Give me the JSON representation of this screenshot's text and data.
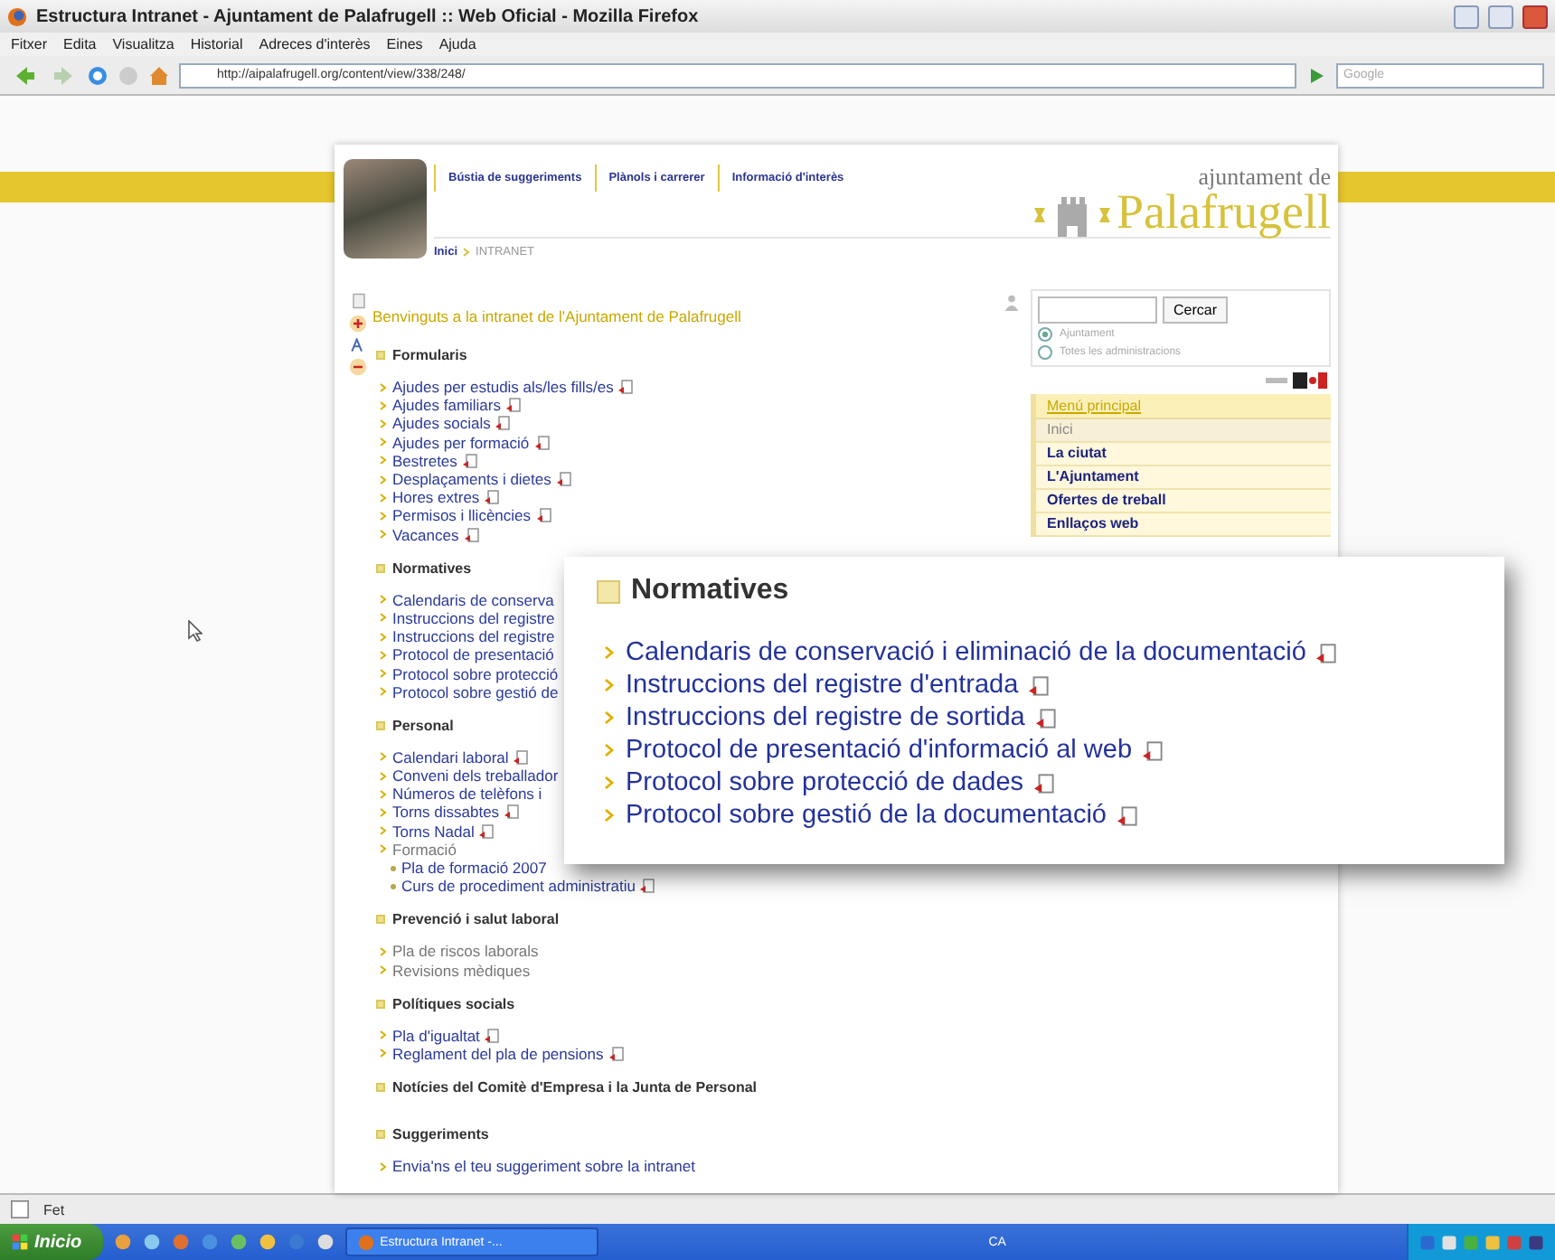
{
  "window": {
    "title": "Estructura Intranet - Ajuntament de Palafrugell :: Web Oficial - Mozilla Firefox",
    "menu": [
      "Fitxer",
      "Edita",
      "Visualitza",
      "Historial",
      "Adreces d'interès",
      "Eines",
      "Ajuda"
    ],
    "address": "http://aipalafrugell.org/content/view/338/248/",
    "search_placeholder": "Google"
  },
  "page": {
    "nav_links": [
      "Bústia de suggeriments",
      "Plànols i carrerer",
      "Informació d'interès"
    ],
    "logo": {
      "line1": "ajuntament de",
      "line2": "Palafrugell"
    },
    "breadcrumb": [
      "Inici",
      "INTRANET"
    ],
    "welcome": "Benvinguts a la intranet de l'Ajuntament de Palafrugell",
    "sections": [
      {
        "title": "Formularis",
        "items": [
          {
            "label": "Ajudes per estudis als/les fills/es",
            "kind": "link",
            "attachment": true
          },
          {
            "label": "Ajudes familiars",
            "kind": "link",
            "attachment": true
          },
          {
            "label": "Ajudes socials",
            "kind": "link",
            "attachment": true
          },
          {
            "label": "Ajudes per formació",
            "kind": "link",
            "attachment": true
          },
          {
            "label": "Bestretes",
            "kind": "link",
            "attachment": true
          },
          {
            "label": "Desplaçaments i dietes",
            "kind": "link",
            "attachment": true
          },
          {
            "label": "Hores extres",
            "kind": "link",
            "attachment": true
          },
          {
            "label": "Permisos i llicències",
            "kind": "link",
            "attachment": true
          },
          {
            "label": "Vacances",
            "kind": "link",
            "attachment": true
          }
        ]
      },
      {
        "title": "Normatives",
        "items": [
          {
            "label": "Calendaris de conserva",
            "kind": "link",
            "attachment": false
          },
          {
            "label": "Instruccions del registre",
            "kind": "link",
            "attachment": false
          },
          {
            "label": "Instruccions del registre",
            "kind": "link",
            "attachment": false
          },
          {
            "label": "Protocol de presentació",
            "kind": "link",
            "attachment": false
          },
          {
            "label": "Protocol sobre protecció",
            "kind": "link",
            "attachment": false
          },
          {
            "label": "Protocol sobre gestió de",
            "kind": "link",
            "attachment": false
          }
        ]
      },
      {
        "title": "Personal",
        "items": [
          {
            "label": "Calendari laboral",
            "kind": "link",
            "attachment": true
          },
          {
            "label": "Conveni dels treballador",
            "kind": "link",
            "attachment": false
          },
          {
            "label": "Números de telèfons i",
            "kind": "link",
            "attachment": false
          },
          {
            "label": "Torns dissabtes",
            "kind": "link",
            "attachment": true
          },
          {
            "label": "Torns Nadal",
            "kind": "link",
            "attachment": true
          },
          {
            "label": "Formació",
            "kind": "text",
            "attachment": false,
            "children": [
              {
                "label": "Pla de formació 2007",
                "kind": "link",
                "attachment": false
              },
              {
                "label": "Curs de procediment administratiu",
                "kind": "link",
                "attachment": true
              }
            ]
          }
        ]
      },
      {
        "title": "Prevenció i salut laboral",
        "items": [
          {
            "label": "Pla de riscos laborals",
            "kind": "text",
            "attachment": false
          },
          {
            "label": "Revisions mèdiques",
            "kind": "text",
            "attachment": false
          }
        ]
      },
      {
        "title": "Polítiques socials",
        "items": [
          {
            "label": "Pla d'igualtat",
            "kind": "link",
            "attachment": true
          },
          {
            "label": "Reglament del pla de pensions",
            "kind": "link",
            "attachment": true
          }
        ]
      },
      {
        "title": "Notícies del Comitè d'Empresa i la Junta de Personal"
      },
      {
        "title": "Suggeriments",
        "items": [
          {
            "label": "Envia'ns el teu suggeriment sobre la intranet",
            "kind": "link",
            "attachment": false
          }
        ]
      }
    ]
  },
  "sidebar": {
    "search": {
      "button": "Cercar",
      "scopes": [
        {
          "label": "Ajuntament",
          "selected": true
        },
        {
          "label": "Totes les administracions",
          "selected": false
        }
      ]
    },
    "menu": {
      "title": "Menú principal",
      "items": [
        {
          "label": "Inici",
          "selected": true
        },
        {
          "label": "La ciutat",
          "selected": false
        },
        {
          "label": "L'Ajuntament",
          "selected": false
        },
        {
          "label": "Ofertes de treball",
          "selected": false
        },
        {
          "label": "Enllaços web",
          "selected": false
        }
      ]
    }
  },
  "callout": {
    "title": "Normatives",
    "items": [
      {
        "label": "Calendaris de conservació i eliminació de la documentació",
        "attachment": true
      },
      {
        "label": "Instruccions del registre d'entrada",
        "attachment": true
      },
      {
        "label": "Instruccions del registre de sortida",
        "attachment": true
      },
      {
        "label": "Protocol de presentació d'informació al web",
        "attachment": true
      },
      {
        "label": "Protocol sobre protecció de dades",
        "attachment": true
      },
      {
        "label": "Protocol sobre gestió de la documentació",
        "attachment": true
      }
    ]
  },
  "status_bar": {
    "text": "Fet"
  },
  "taskbar": {
    "start": "Inicio",
    "tasks": [
      "Estructura Intranet -..."
    ],
    "language": "CA"
  }
}
